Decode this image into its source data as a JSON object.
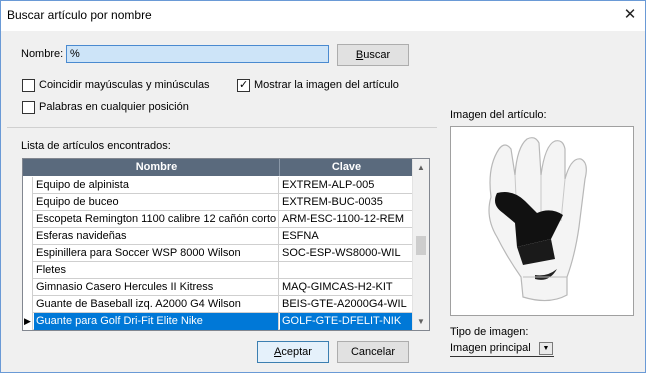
{
  "window": {
    "title": "Buscar artículo por nombre",
    "close_glyph": "✕"
  },
  "search": {
    "label": "Nombre:",
    "value": "%",
    "button_prefix": "",
    "button_accel": "B",
    "button_rest": "uscar"
  },
  "options": {
    "match_case": {
      "label": "Coincidir mayúsculas y minúsculas",
      "checked": false
    },
    "show_image": {
      "label": "Mostrar la imagen del artículo",
      "checked": true
    },
    "any_position": {
      "label": "Palabras en cualquier posición",
      "checked": false
    }
  },
  "list": {
    "caption": "Lista de artículos encontrados:",
    "columns": [
      "Nombre",
      "Clave"
    ],
    "rows": [
      {
        "name": "Equipo de alpinista",
        "key": "EXTREM-ALP-005"
      },
      {
        "name": "Equipo de buceo",
        "key": "EXTREM-BUC-0035"
      },
      {
        "name": "Escopeta Remington 1100 calibre 12 cañón corto",
        "key": "ARM-ESC-1100-12-REM"
      },
      {
        "name": "Esferas navideñas",
        "key": "ESFNA"
      },
      {
        "name": "Espinillera para Soccer WSP 8000 Wilson",
        "key": "SOC-ESP-WS8000-WIL"
      },
      {
        "name": "Fletes",
        "key": ""
      },
      {
        "name": "Gimnasio Casero Hercules II Kitress",
        "key": "MAQ-GIMCAS-H2-KIT"
      },
      {
        "name": "Guante de Baseball izq. A2000 G4 Wilson",
        "key": "BEIS-GTE-A2000G4-WIL"
      },
      {
        "name": "Guante para Golf Dri-Fit Elite Nike",
        "key": "GOLF-GTE-DFELIT-NIK"
      }
    ],
    "selected_index": 8,
    "current_row_marker": "▶",
    "scroll_up": "▲",
    "scroll_down": "▼"
  },
  "image_panel": {
    "caption": "Imagen del artículo:",
    "image_kind": "golf-glove"
  },
  "image_type": {
    "label": "Tipo de imagen:",
    "value": "Imagen principal",
    "arrow": "▼"
  },
  "actions": {
    "accept_accel": "A",
    "accept_rest": "ceptar",
    "cancel": "Cancelar"
  }
}
